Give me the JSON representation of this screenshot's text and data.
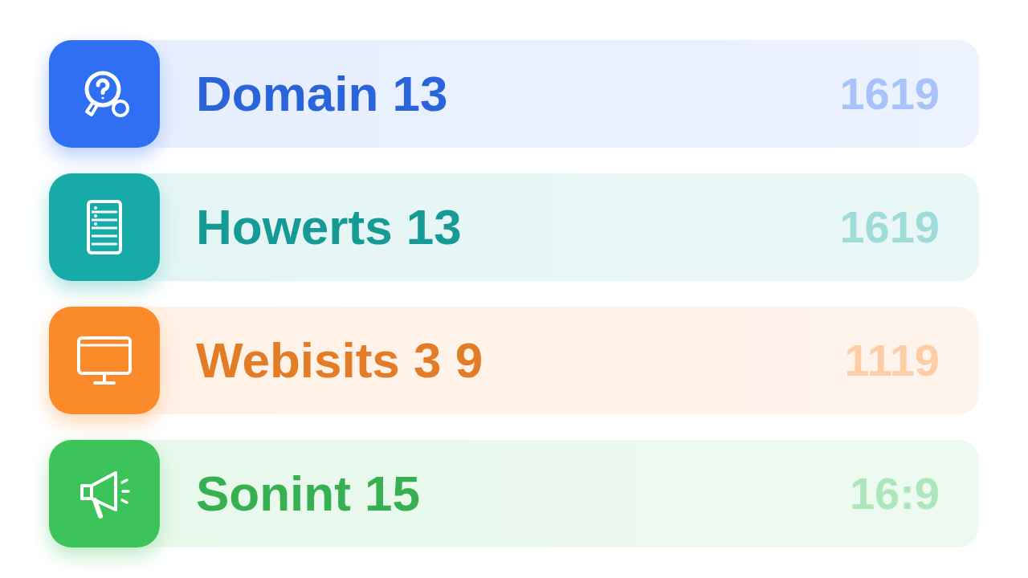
{
  "items": [
    {
      "kind": "help-search",
      "label": "Domain 13",
      "value": "1619",
      "color": "#2f6ff3"
    },
    {
      "kind": "server",
      "label": "Howerts 13",
      "value": "1619",
      "color": "#17aba7"
    },
    {
      "kind": "monitor",
      "label": "Webisits 3 9",
      "value": "1119",
      "color": "#fb8a2b"
    },
    {
      "kind": "megaphone",
      "label": "Sonint 15",
      "value": "16:9",
      "color": "#3cc35a"
    }
  ]
}
